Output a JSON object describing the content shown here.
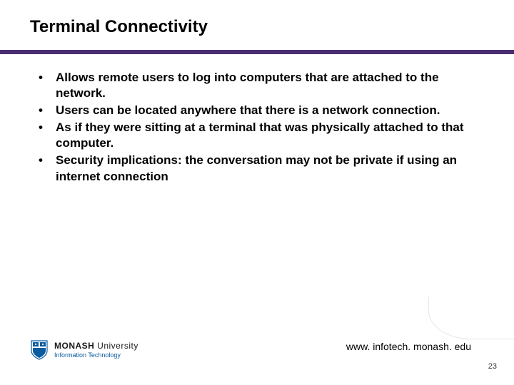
{
  "title": "Terminal Connectivity",
  "bullets": [
    "Allows remote users to log into computers that are attached to the network.",
    "Users can be located anywhere that there is a network connection.",
    "As if they were sitting at a terminal that was physically attached to that computer.",
    "Security implications: the conversation may not be private if using an internet connection"
  ],
  "logo": {
    "main_bold": "MONASH",
    "main_rest": " University",
    "sub": "Information Technology"
  },
  "footer_url": "www. infotech. monash. edu",
  "page_number": "23"
}
